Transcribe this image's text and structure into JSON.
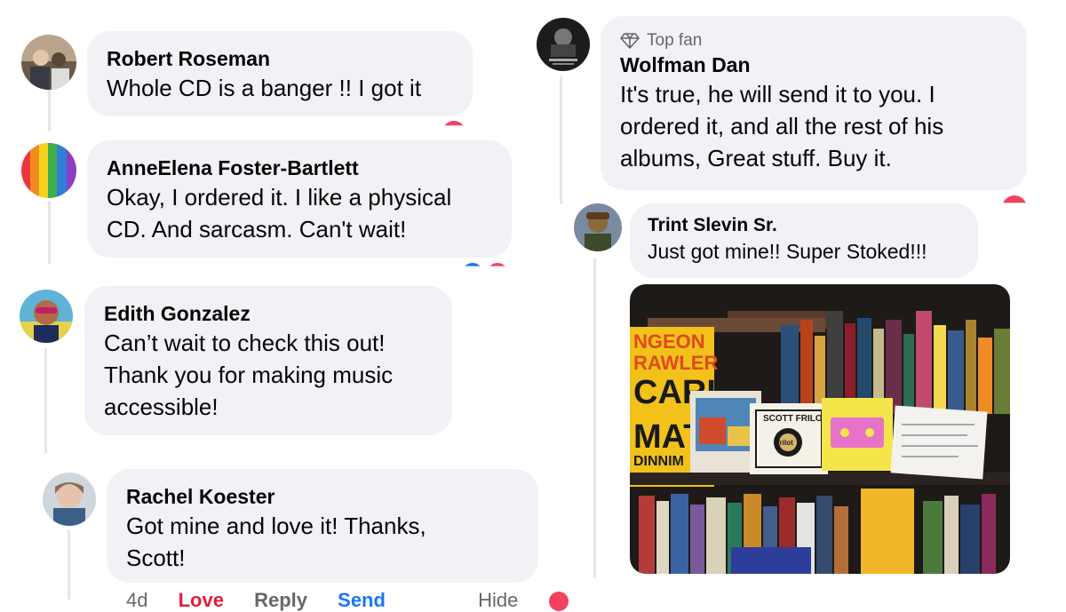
{
  "comments": [
    {
      "name": "Robert Roseman",
      "lines": [
        "Whole CD is a banger !! I got it"
      ]
    },
    {
      "name": "AnneElena Foster-Bartlett",
      "lines": [
        "Okay, I ordered it. I like a physical",
        "CD. And sarcasm. Can't wait!"
      ]
    },
    {
      "name": "Edith Gonzalez",
      "lines": [
        "Can’t wait to check this out!",
        "Thank you for making music",
        "accessible!"
      ]
    },
    {
      "name": "Rachel Koester",
      "lines": [
        "Got mine and love it! Thanks,",
        "Scott!"
      ]
    },
    {
      "badge": "Top fan",
      "name": "Wolfman Dan",
      "lines": [
        "It's true, he will send it to you. I",
        "ordered it, and all the rest of his",
        "albums, Great stuff. Buy it."
      ]
    },
    {
      "name": "Trint Slevin Sr.",
      "lines": [
        "Just got mine!! Super Stoked!!!"
      ]
    }
  ],
  "actions": {
    "time": "4d",
    "love": "Love",
    "reply": "Reply",
    "send": "Send",
    "hide": "Hide"
  },
  "photo": {
    "book_spine": [
      "NGEON",
      "RAWLER",
      "CARL",
      "MAT",
      "DINNIM"
    ],
    "cd_label": "SCOTT FRILOT",
    "cd_center": "frilot"
  },
  "colors": {
    "bubble": "#f0f2f5",
    "name": "#050505",
    "meta": "#65676b",
    "love": "#e41e3f",
    "send": "#1877f2"
  }
}
